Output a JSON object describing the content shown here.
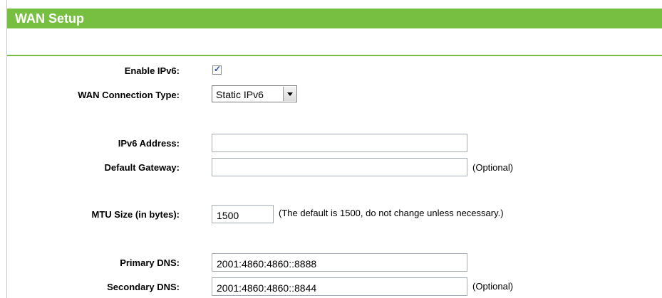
{
  "header": {
    "title": "WAN Setup"
  },
  "form": {
    "enable_ipv6": {
      "label": "Enable IPv6:",
      "checked": true
    },
    "wan_connection_type": {
      "label": "WAN Connection Type:",
      "value": "Static IPv6"
    },
    "ipv6_address": {
      "label": "IPv6 Address:",
      "value": ""
    },
    "default_gateway": {
      "label": "Default Gateway:",
      "value": "",
      "note": "(Optional)"
    },
    "mtu_size": {
      "label": "MTU Size (in bytes):",
      "value": "1500",
      "note": "(The default is 1500, do not change unless necessary.)"
    },
    "primary_dns": {
      "label": "Primary DNS:",
      "value": "2001:4860:4860::8888"
    },
    "secondary_dns": {
      "label": "Secondary DNS:",
      "value": "2001:4860:4860::8844",
      "note": "(Optional)"
    }
  },
  "colors": {
    "accent": "#77bf41"
  }
}
